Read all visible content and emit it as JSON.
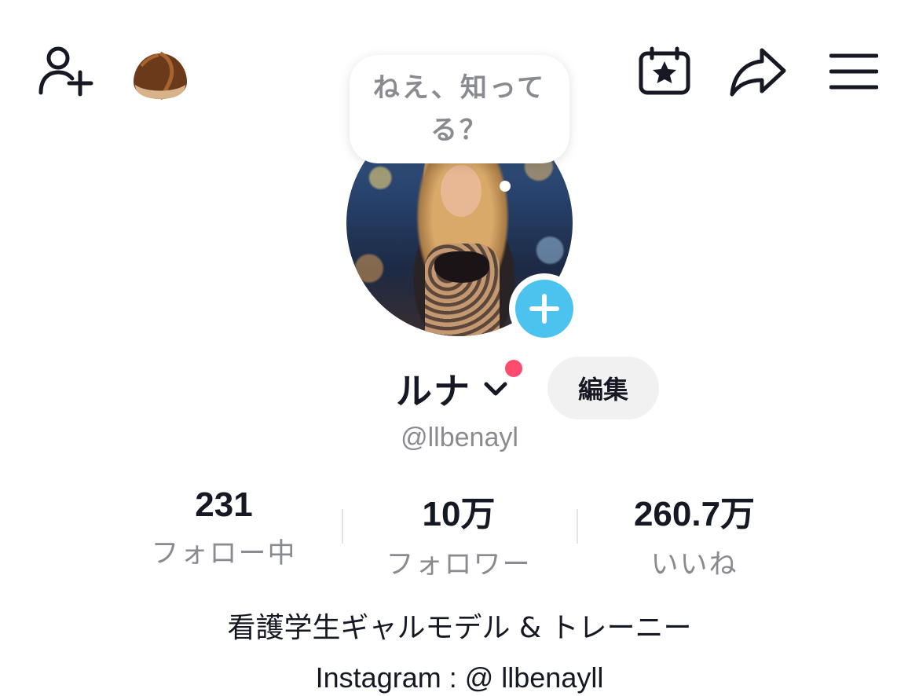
{
  "header": {
    "icons": [
      "add-friend-icon",
      "chestnut-icon",
      "calendar-star-icon",
      "share-icon",
      "menu-icon"
    ]
  },
  "bubble": {
    "text": "ねえ、知ってる？"
  },
  "profile": {
    "name": "ルナ",
    "edit_label": "編集",
    "handle": "@llbenayl"
  },
  "stats": [
    {
      "value": "231",
      "label": "フォロー中"
    },
    {
      "value": "10万",
      "label": "フォロワー"
    },
    {
      "value": "260.7万",
      "label": "いいね"
    }
  ],
  "bio": {
    "line1": "看護学生ギャルモデル & トレーニー",
    "line2": "Instagram : @ llbenayll"
  },
  "colors": {
    "accent_blue": "#4cc3ee",
    "notification_red": "#fe2c55",
    "muted_text": "#8a8b91"
  }
}
